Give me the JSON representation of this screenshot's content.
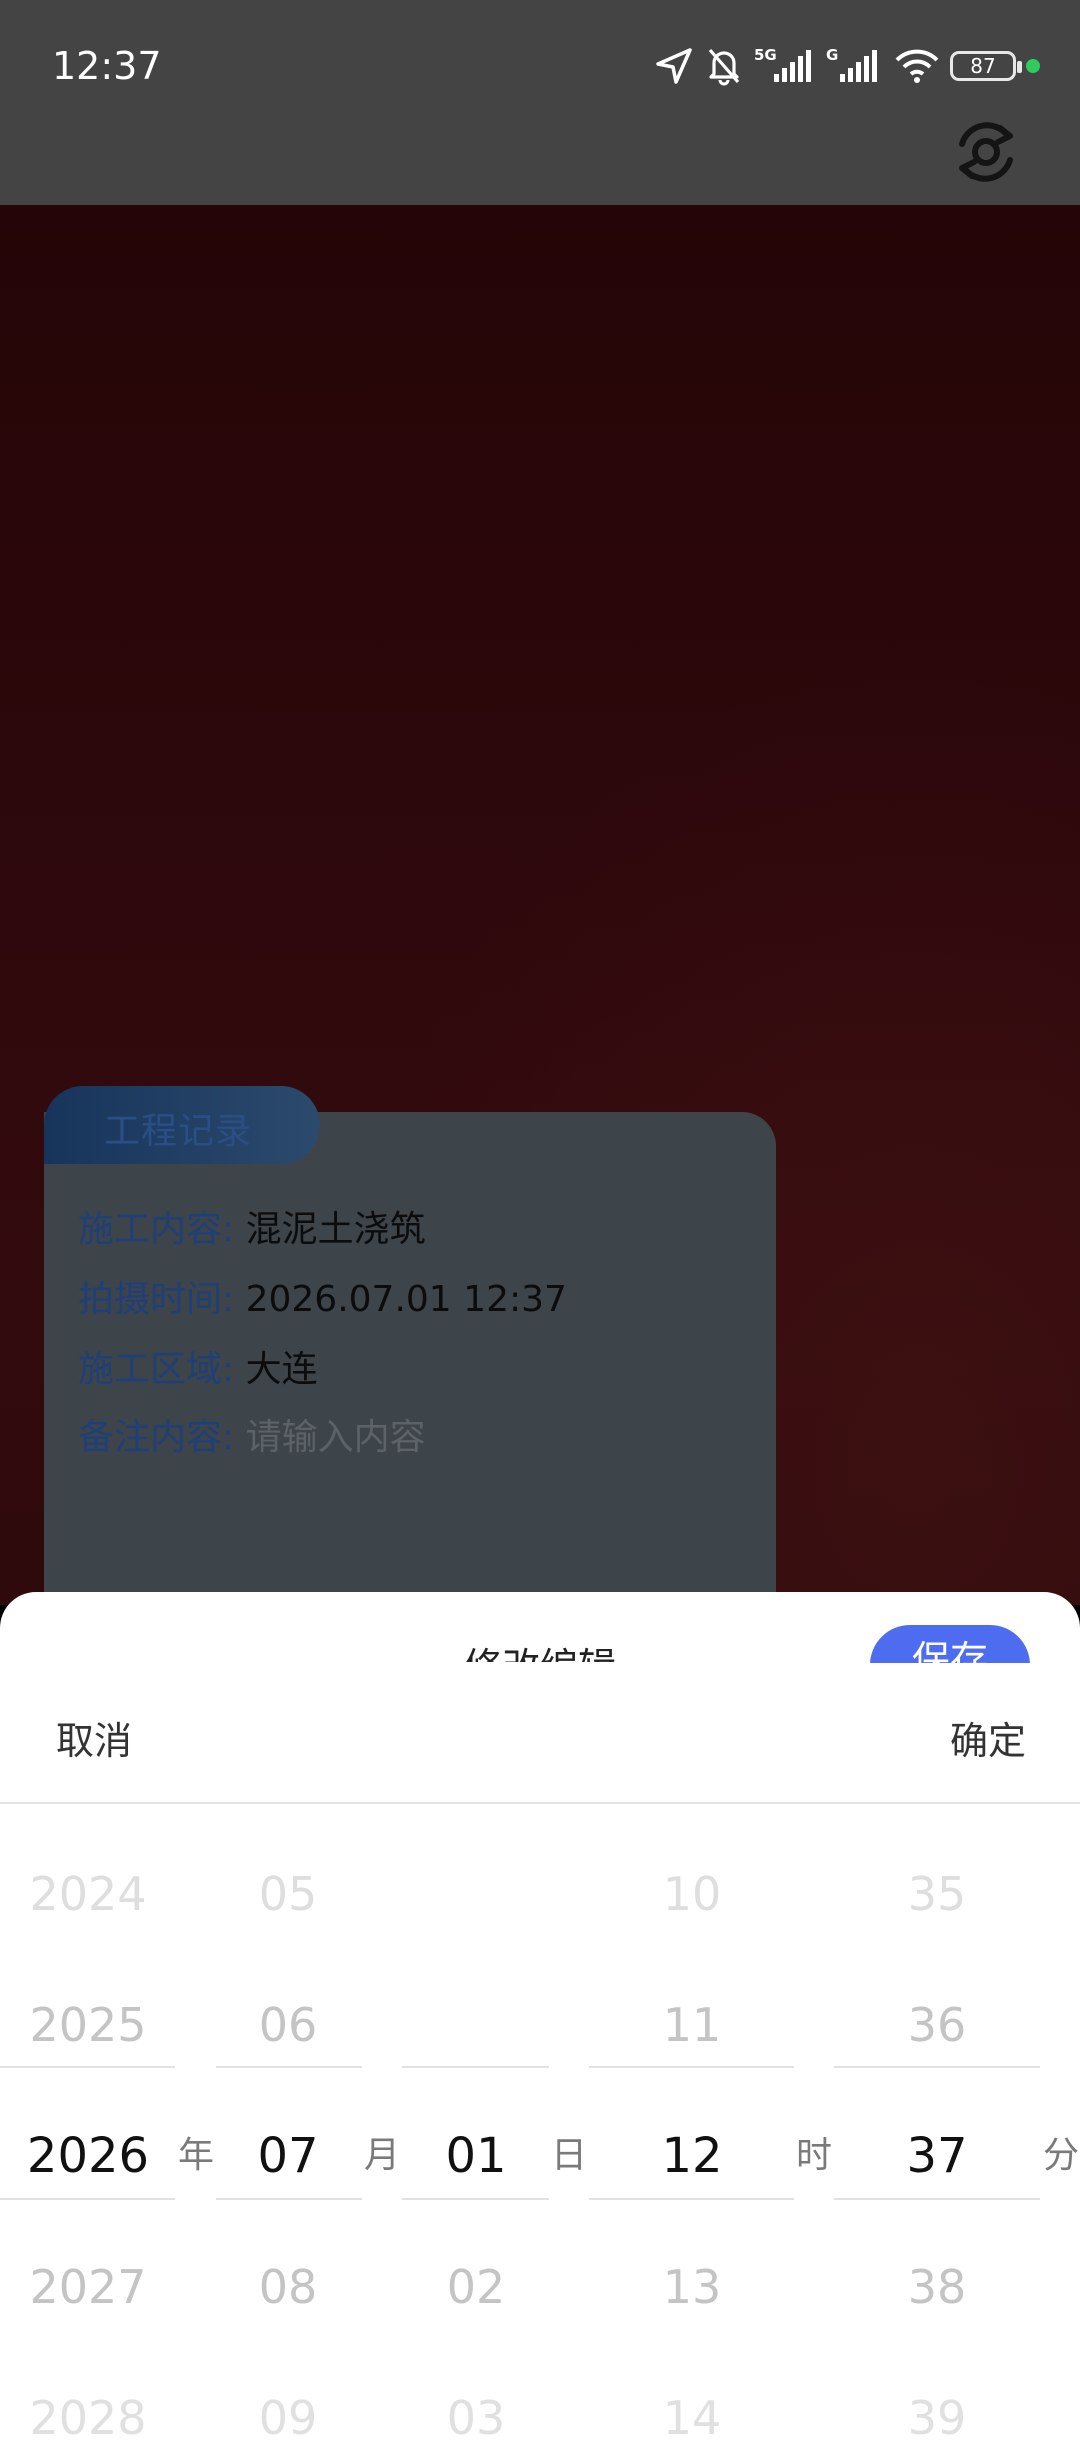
{
  "status_bar": {
    "time": "12:37",
    "battery": "87",
    "icons": [
      "location-icon",
      "mute-bell-icon",
      "signal-5g-icon",
      "signal-g-icon",
      "wifi-icon",
      "battery-icon",
      "privacy-indicator-dot"
    ],
    "signal_label_1": "5G",
    "signal_label_2": "G",
    "privacy_dot_color": "#2ecc5b"
  },
  "camera": {
    "switch_icon": "camera-switch-icon"
  },
  "watermark_card": {
    "tab_title": "工程记录",
    "rows": [
      {
        "key": "施工内容:",
        "value": "混泥土浇筑"
      },
      {
        "key": "拍摄时间:",
        "value": "2026.07.01 12:37"
      },
      {
        "key": "施工区域:",
        "value": "大连"
      },
      {
        "key": "备注内容:",
        "placeholder": "请输入内容"
      }
    ]
  },
  "sheet": {
    "title": "修改编辑",
    "save_label": "保存",
    "accent_color": "#4d6cf0"
  },
  "picker": {
    "cancel_label": "取消",
    "confirm_label": "确定",
    "columns": [
      {
        "name": "year",
        "unit": "年",
        "values": [
          "2024",
          "2025",
          "2026",
          "2027",
          "2028"
        ],
        "selected": "2026"
      },
      {
        "name": "month",
        "unit": "月",
        "values": [
          "05",
          "06",
          "07",
          "08",
          "09"
        ],
        "selected": "07"
      },
      {
        "name": "day",
        "unit": "日",
        "values": [
          "",
          "",
          "01",
          "02",
          "03"
        ],
        "selected": "01"
      },
      {
        "name": "hour",
        "unit": "时",
        "values": [
          "10",
          "11",
          "12",
          "13",
          "14"
        ],
        "selected": "12"
      },
      {
        "name": "minute",
        "unit": "分",
        "values": [
          "35",
          "36",
          "37",
          "38",
          "39"
        ],
        "selected": "37"
      }
    ]
  }
}
